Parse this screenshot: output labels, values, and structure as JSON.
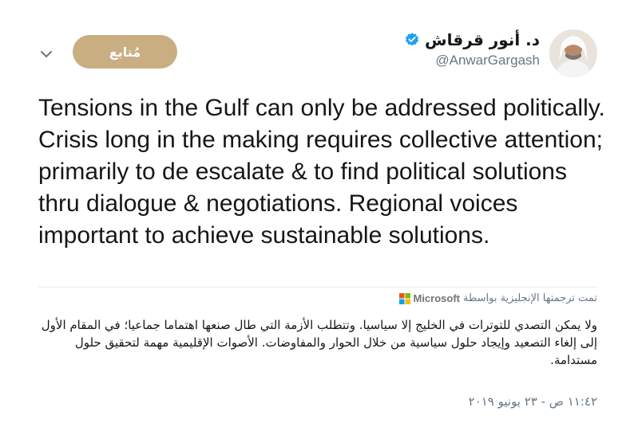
{
  "header": {
    "follow_label": "مُتابع",
    "display_name": "د. أنور قرقاش",
    "handle": "@AnwarGargash"
  },
  "tweet": {
    "text": "Tensions in the Gulf can only be addressed politically. Crisis long in the making requires collective attention; primarily to de escalate & to find political solutions thru dialogue & negotiations. Regional voices important to achieve sustainable solutions."
  },
  "translation": {
    "translated_by_label": "تمت ترجمتها الإنجليزية بواسطة",
    "provider": "Microsoft",
    "text": "ولا يمكن التصدي للتوترات في الخليج إلا سياسيا. وتتطلب الأزمة التي طال صنعها اهتماما جماعيا؛ في المقام الأول إلى إلغاء التصعيد وإيجاد حلول سياسية من خلال الحوار والمفاوضات. الأصوات الإقليمية مهمة لتحقيق حلول مستدامة."
  },
  "timestamp": "١١:٤٢ ص - ٢٣ يونيو ٢٠١٩",
  "icons": {
    "more": "chevron-down-icon",
    "verified": "verified-badge-icon",
    "provider_logo": "microsoft-logo"
  },
  "colors": {
    "follow_button": "#c9ae82",
    "verified": "#1da1f2",
    "muted_text": "#657786"
  }
}
